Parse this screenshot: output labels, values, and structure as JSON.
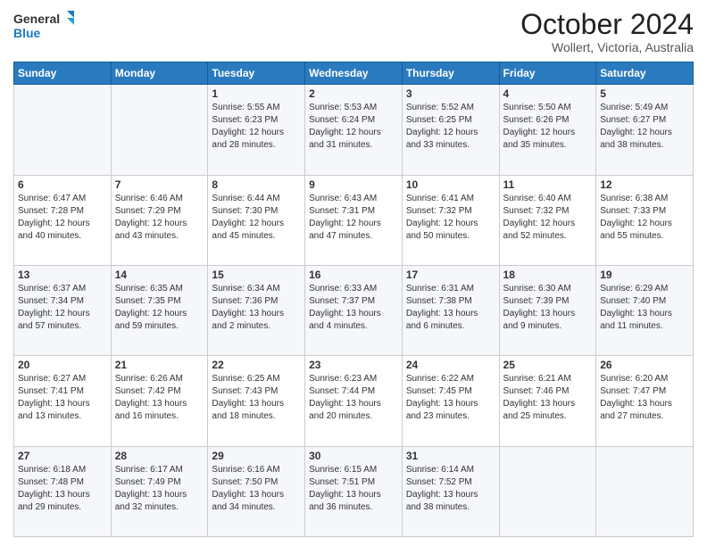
{
  "logo": {
    "line1": "General",
    "line2": "Blue"
  },
  "title": "October 2024",
  "location": "Wollert, Victoria, Australia",
  "days_of_week": [
    "Sunday",
    "Monday",
    "Tuesday",
    "Wednesday",
    "Thursday",
    "Friday",
    "Saturday"
  ],
  "weeks": [
    [
      {
        "day": "",
        "info": ""
      },
      {
        "day": "",
        "info": ""
      },
      {
        "day": "1",
        "sunrise": "Sunrise: 5:55 AM",
        "sunset": "Sunset: 6:23 PM",
        "daylight": "Daylight: 12 hours and 28 minutes."
      },
      {
        "day": "2",
        "sunrise": "Sunrise: 5:53 AM",
        "sunset": "Sunset: 6:24 PM",
        "daylight": "Daylight: 12 hours and 31 minutes."
      },
      {
        "day": "3",
        "sunrise": "Sunrise: 5:52 AM",
        "sunset": "Sunset: 6:25 PM",
        "daylight": "Daylight: 12 hours and 33 minutes."
      },
      {
        "day": "4",
        "sunrise": "Sunrise: 5:50 AM",
        "sunset": "Sunset: 6:26 PM",
        "daylight": "Daylight: 12 hours and 35 minutes."
      },
      {
        "day": "5",
        "sunrise": "Sunrise: 5:49 AM",
        "sunset": "Sunset: 6:27 PM",
        "daylight": "Daylight: 12 hours and 38 minutes."
      }
    ],
    [
      {
        "day": "6",
        "sunrise": "Sunrise: 6:47 AM",
        "sunset": "Sunset: 7:28 PM",
        "daylight": "Daylight: 12 hours and 40 minutes."
      },
      {
        "day": "7",
        "sunrise": "Sunrise: 6:46 AM",
        "sunset": "Sunset: 7:29 PM",
        "daylight": "Daylight: 12 hours and 43 minutes."
      },
      {
        "day": "8",
        "sunrise": "Sunrise: 6:44 AM",
        "sunset": "Sunset: 7:30 PM",
        "daylight": "Daylight: 12 hours and 45 minutes."
      },
      {
        "day": "9",
        "sunrise": "Sunrise: 6:43 AM",
        "sunset": "Sunset: 7:31 PM",
        "daylight": "Daylight: 12 hours and 47 minutes."
      },
      {
        "day": "10",
        "sunrise": "Sunrise: 6:41 AM",
        "sunset": "Sunset: 7:32 PM",
        "daylight": "Daylight: 12 hours and 50 minutes."
      },
      {
        "day": "11",
        "sunrise": "Sunrise: 6:40 AM",
        "sunset": "Sunset: 7:32 PM",
        "daylight": "Daylight: 12 hours and 52 minutes."
      },
      {
        "day": "12",
        "sunrise": "Sunrise: 6:38 AM",
        "sunset": "Sunset: 7:33 PM",
        "daylight": "Daylight: 12 hours and 55 minutes."
      }
    ],
    [
      {
        "day": "13",
        "sunrise": "Sunrise: 6:37 AM",
        "sunset": "Sunset: 7:34 PM",
        "daylight": "Daylight: 12 hours and 57 minutes."
      },
      {
        "day": "14",
        "sunrise": "Sunrise: 6:35 AM",
        "sunset": "Sunset: 7:35 PM",
        "daylight": "Daylight: 12 hours and 59 minutes."
      },
      {
        "day": "15",
        "sunrise": "Sunrise: 6:34 AM",
        "sunset": "Sunset: 7:36 PM",
        "daylight": "Daylight: 13 hours and 2 minutes."
      },
      {
        "day": "16",
        "sunrise": "Sunrise: 6:33 AM",
        "sunset": "Sunset: 7:37 PM",
        "daylight": "Daylight: 13 hours and 4 minutes."
      },
      {
        "day": "17",
        "sunrise": "Sunrise: 6:31 AM",
        "sunset": "Sunset: 7:38 PM",
        "daylight": "Daylight: 13 hours and 6 minutes."
      },
      {
        "day": "18",
        "sunrise": "Sunrise: 6:30 AM",
        "sunset": "Sunset: 7:39 PM",
        "daylight": "Daylight: 13 hours and 9 minutes."
      },
      {
        "day": "19",
        "sunrise": "Sunrise: 6:29 AM",
        "sunset": "Sunset: 7:40 PM",
        "daylight": "Daylight: 13 hours and 11 minutes."
      }
    ],
    [
      {
        "day": "20",
        "sunrise": "Sunrise: 6:27 AM",
        "sunset": "Sunset: 7:41 PM",
        "daylight": "Daylight: 13 hours and 13 minutes."
      },
      {
        "day": "21",
        "sunrise": "Sunrise: 6:26 AM",
        "sunset": "Sunset: 7:42 PM",
        "daylight": "Daylight: 13 hours and 16 minutes."
      },
      {
        "day": "22",
        "sunrise": "Sunrise: 6:25 AM",
        "sunset": "Sunset: 7:43 PM",
        "daylight": "Daylight: 13 hours and 18 minutes."
      },
      {
        "day": "23",
        "sunrise": "Sunrise: 6:23 AM",
        "sunset": "Sunset: 7:44 PM",
        "daylight": "Daylight: 13 hours and 20 minutes."
      },
      {
        "day": "24",
        "sunrise": "Sunrise: 6:22 AM",
        "sunset": "Sunset: 7:45 PM",
        "daylight": "Daylight: 13 hours and 23 minutes."
      },
      {
        "day": "25",
        "sunrise": "Sunrise: 6:21 AM",
        "sunset": "Sunset: 7:46 PM",
        "daylight": "Daylight: 13 hours and 25 minutes."
      },
      {
        "day": "26",
        "sunrise": "Sunrise: 6:20 AM",
        "sunset": "Sunset: 7:47 PM",
        "daylight": "Daylight: 13 hours and 27 minutes."
      }
    ],
    [
      {
        "day": "27",
        "sunrise": "Sunrise: 6:18 AM",
        "sunset": "Sunset: 7:48 PM",
        "daylight": "Daylight: 13 hours and 29 minutes."
      },
      {
        "day": "28",
        "sunrise": "Sunrise: 6:17 AM",
        "sunset": "Sunset: 7:49 PM",
        "daylight": "Daylight: 13 hours and 32 minutes."
      },
      {
        "day": "29",
        "sunrise": "Sunrise: 6:16 AM",
        "sunset": "Sunset: 7:50 PM",
        "daylight": "Daylight: 13 hours and 34 minutes."
      },
      {
        "day": "30",
        "sunrise": "Sunrise: 6:15 AM",
        "sunset": "Sunset: 7:51 PM",
        "daylight": "Daylight: 13 hours and 36 minutes."
      },
      {
        "day": "31",
        "sunrise": "Sunrise: 6:14 AM",
        "sunset": "Sunset: 7:52 PM",
        "daylight": "Daylight: 13 hours and 38 minutes."
      },
      {
        "day": "",
        "info": ""
      },
      {
        "day": "",
        "info": ""
      }
    ]
  ]
}
